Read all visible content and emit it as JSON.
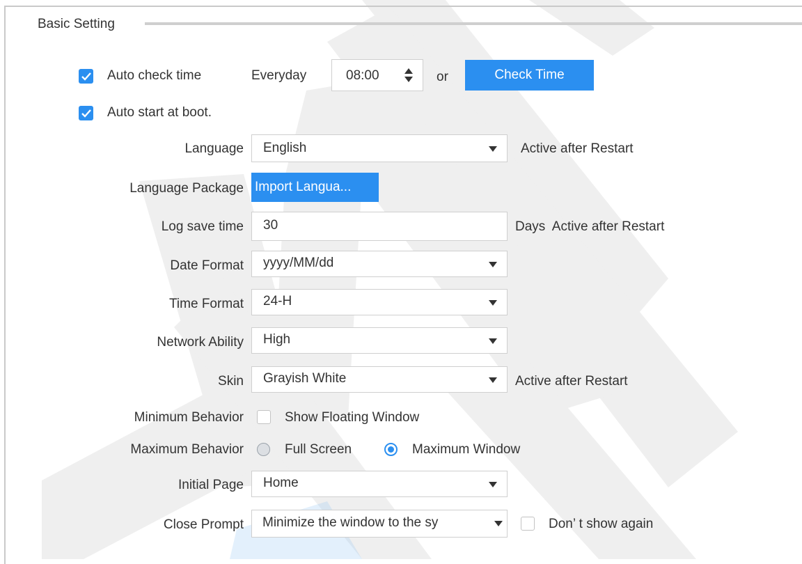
{
  "group_title": "Basic Setting",
  "auto_check_time": {
    "checked": true,
    "label": "Auto check time",
    "frequency": "Everyday",
    "time": "08:00",
    "or": "or",
    "button": "Check Time"
  },
  "auto_start": {
    "checked": true,
    "label": "Auto start at boot."
  },
  "language": {
    "label": "Language",
    "value": "English",
    "note": "Active after Restart"
  },
  "language_package": {
    "label": "Language Package",
    "button": "Import Langua..."
  },
  "log_save_time": {
    "label": "Log save time",
    "value": "30",
    "note": "Days  Active after Restart"
  },
  "date_format": {
    "label": "Date Format",
    "value": "yyyy/MM/dd"
  },
  "time_format": {
    "label": "Time Format",
    "value": "24-H"
  },
  "network_ability": {
    "label": "Network Ability",
    "value": "High"
  },
  "skin": {
    "label": "Skin",
    "value": "Grayish White",
    "note": "Active after Restart"
  },
  "minimum_behavior": {
    "label": "Minimum Behavior",
    "option": "Show Floating Window",
    "checked": false
  },
  "maximum_behavior": {
    "label": "Maximum Behavior",
    "options": [
      "Full Screen",
      "Maximum Window"
    ],
    "selected": "Maximum Window"
  },
  "initial_page": {
    "label": "Initial Page",
    "value": "Home"
  },
  "close_prompt": {
    "label": "Close Prompt",
    "value": "Minimize the window to the sy",
    "dont_show": "Don’ t show again",
    "dont_show_checked": false
  },
  "colors": {
    "accent": "#2b8ff0",
    "watermark": "#b8b8b8",
    "watermark_blue": "#90c3f5"
  }
}
